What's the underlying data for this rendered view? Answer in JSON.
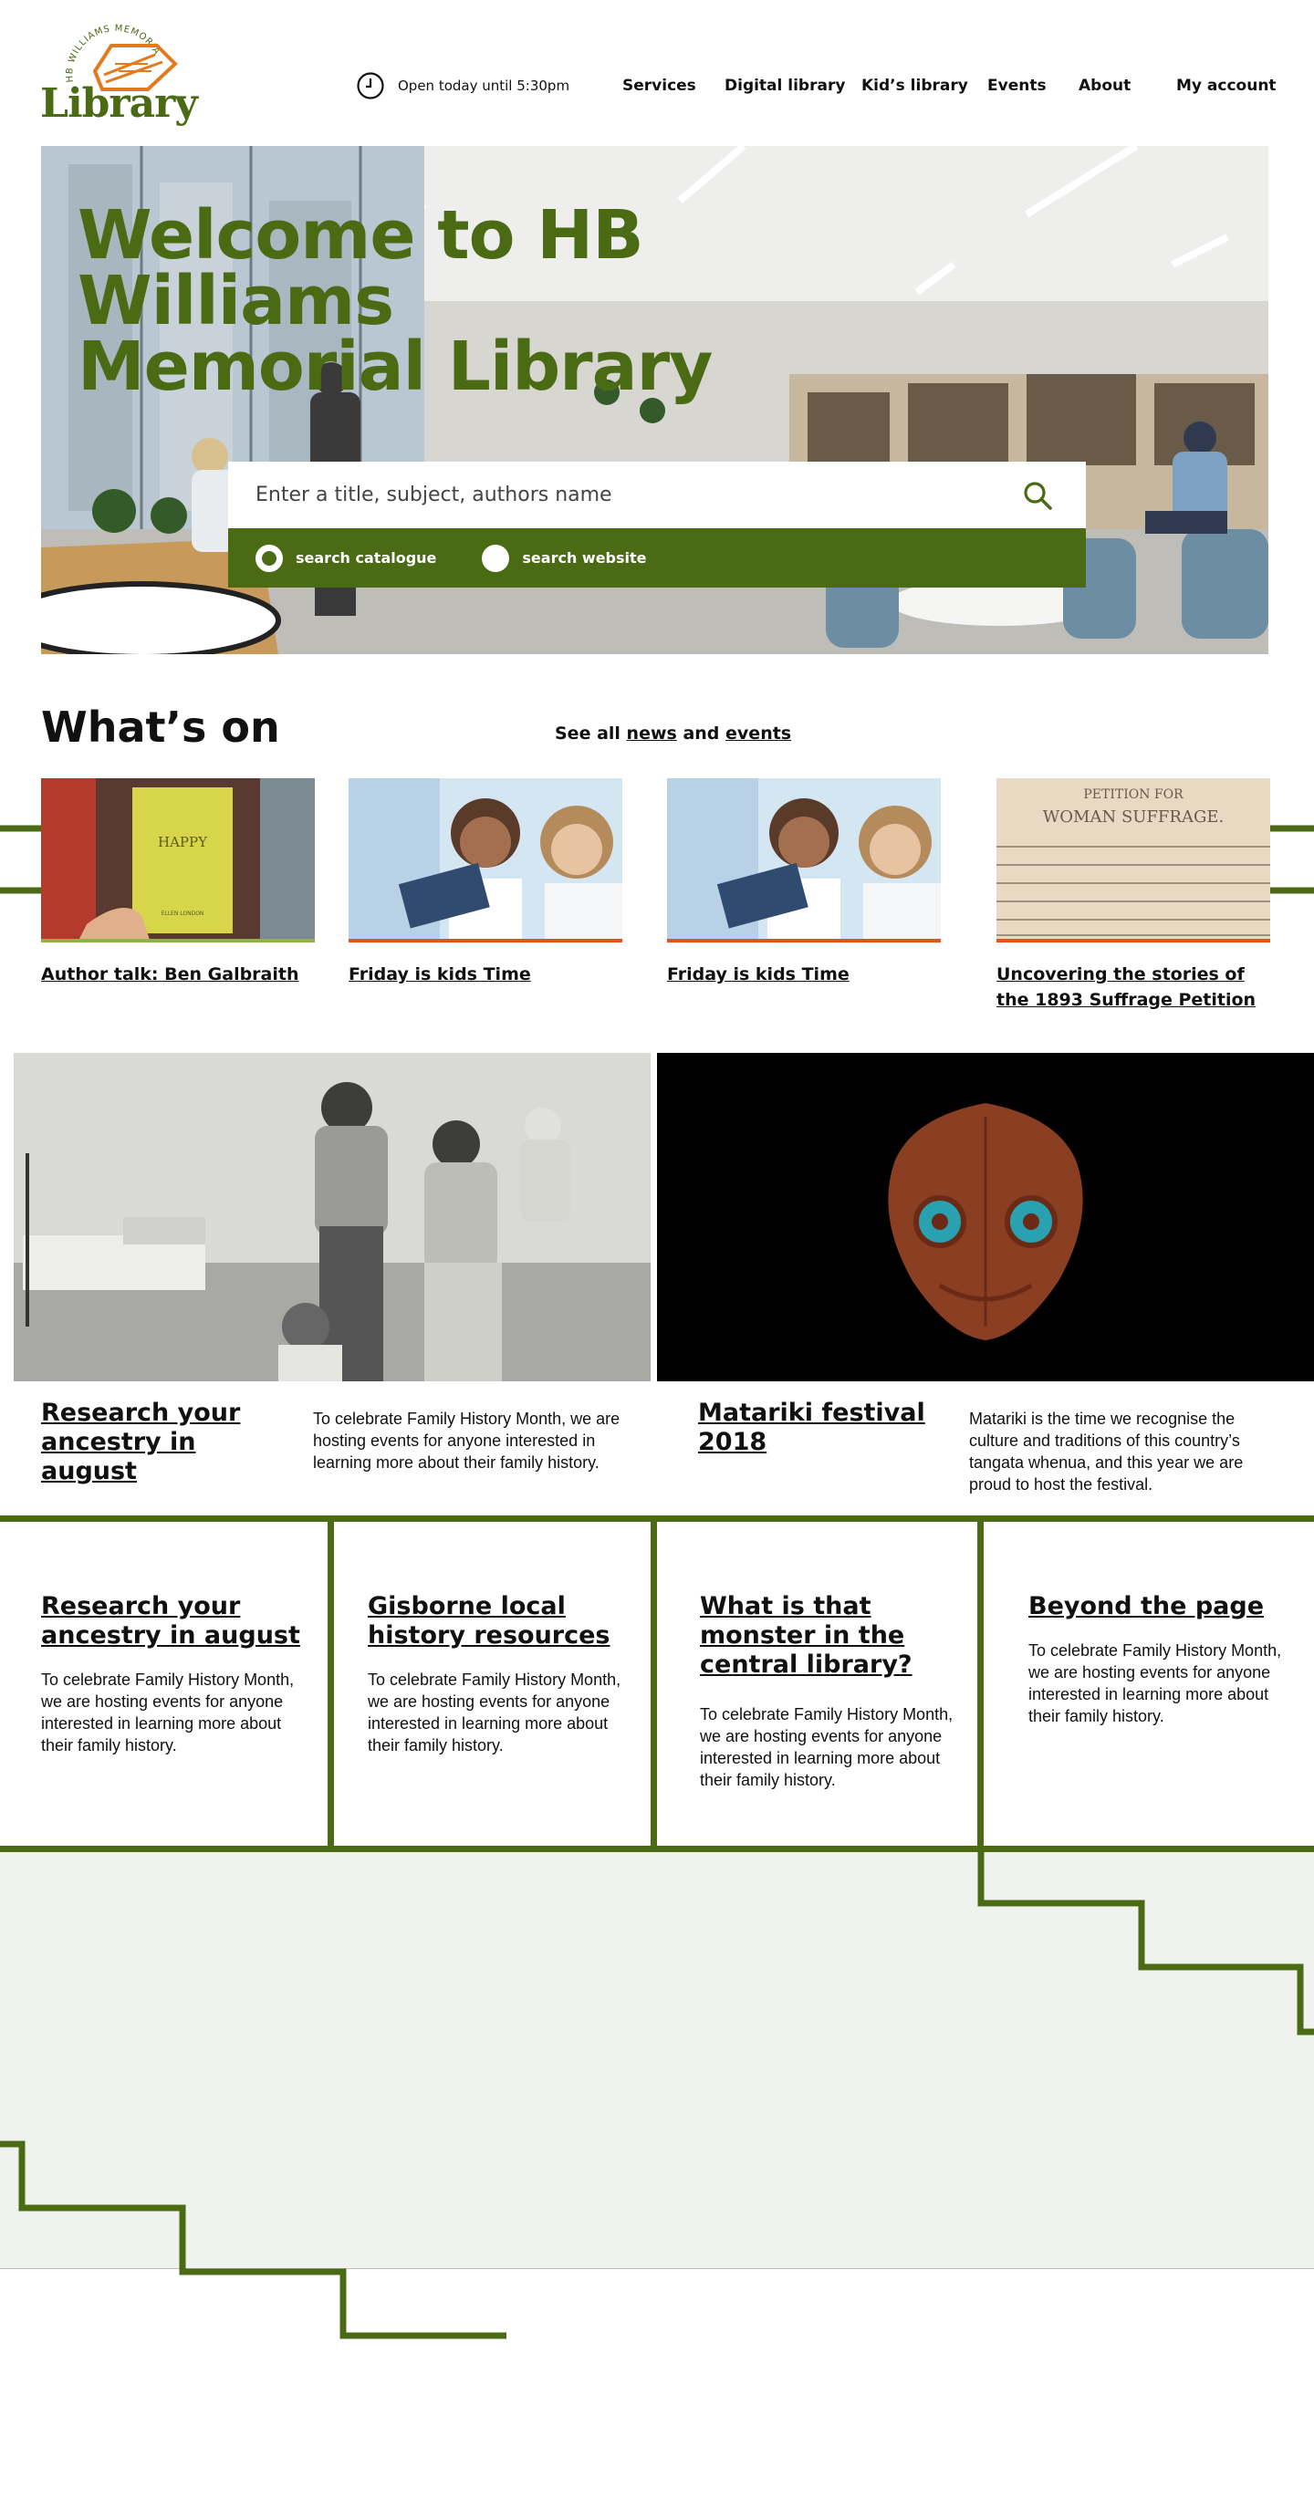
{
  "header": {
    "logo_arc_text": "HB WILLIAMS MEMORIAL",
    "logo_word": "Library",
    "hours": "Open today until 5:30pm",
    "nav": [
      "Services",
      "Digital library",
      "Kid’s library",
      "Events",
      "About",
      "My account"
    ]
  },
  "hero": {
    "title_line1": "Welcome to HB Williams",
    "title_line2": "Memorial Library",
    "search_placeholder": "Enter a title, subject, authors name",
    "options": [
      "search catalogue",
      "search website"
    ],
    "selected_option": "search catalogue"
  },
  "whats_on": {
    "title": "What’s on",
    "see_all_prefix": "See all",
    "see_all_news": "news",
    "see_all_and": "and",
    "see_all_events": "events",
    "events": [
      {
        "title": "Author talk: Ben Galbraith",
        "book_title": "HAPPY",
        "book_author": "ELLEN LONDON"
      },
      {
        "title": "Friday is kids Time"
      },
      {
        "title": "Friday is kids Time"
      },
      {
        "title": "Uncovering the stories of the 1893 Suffrage Petition",
        "doc_heading1": "PETITION FOR",
        "doc_heading2": "WOMAN SUFFRAGE."
      }
    ]
  },
  "features": [
    {
      "heading": "Research your ancestry in august",
      "text": "To celebrate Family History Month, we are hosting events for anyone interested in learning more about their family history."
    },
    {
      "heading": "Matariki festival 2018",
      "text": "Matariki is the time we recognise the culture and traditions of this country’s tangata whenua, and this year we are proud to host the festival."
    }
  ],
  "cards": [
    {
      "heading": "Research your ancestry in august",
      "text": "To celebrate Family History Month, we are hosting events for anyone interested in learning more about their family history."
    },
    {
      "heading": "Gisborne local history resources",
      "text": "To celebrate Family History Month, we are hosting events for anyone interested in learning more about their family history."
    },
    {
      "heading": "What is that monster in the central library?",
      "text": "To celebrate Family History Month, we are hosting events for anyone interested in learning more about their family history."
    },
    {
      "heading": "Beyond the page",
      "text": "To celebrate Family History Month, we are hosting events for anyone interested in learning more about their family history."
    }
  ],
  "colors": {
    "brand_green": "#4a6b14",
    "logo_orange": "#e37a1e",
    "event_underline_orange": "#e2541c",
    "event_underline_green": "#8fb34a",
    "footer_bg": "#f0f2ee"
  },
  "icons": [
    "clock-icon",
    "search-icon"
  ]
}
